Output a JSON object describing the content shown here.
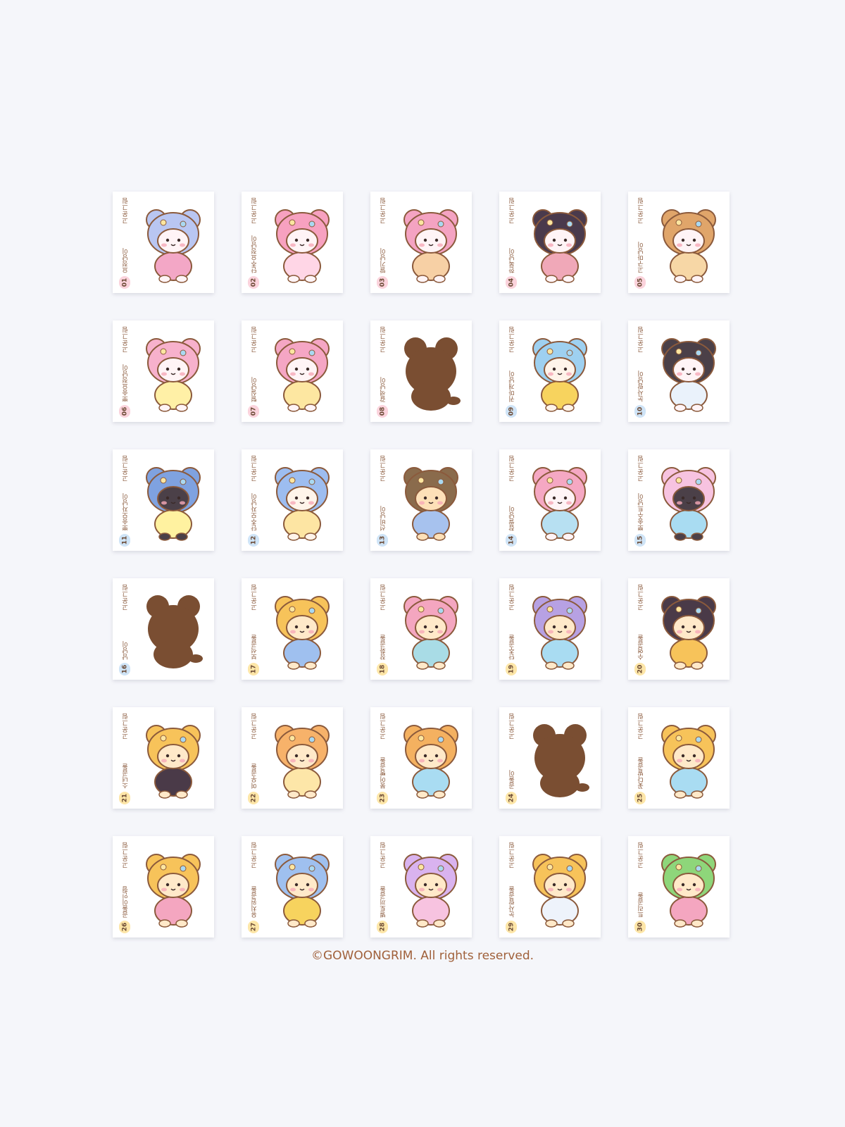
{
  "brand_text": "고운그림",
  "footer": "©GOWOONGRIM. All rights reserved.",
  "stickers": [
    {
      "number": "01",
      "name": "요정냥이",
      "variant": "character",
      "badge_color": "#fbd3dc",
      "colors": [
        "#b9c6f2",
        "#f3a7c6",
        "#fff4f6"
      ]
    },
    {
      "number": "02",
      "name": "단추요정냥이",
      "variant": "character",
      "badge_color": "#fbd3dc",
      "colors": [
        "#f7a1c0",
        "#ffd6e6",
        "#fff4f6"
      ]
    },
    {
      "number": "03",
      "name": "딸기냥이",
      "variant": "character",
      "badge_color": "#fbd3dc",
      "colors": [
        "#f4a3c2",
        "#f7d0a5",
        "#fff4f6"
      ]
    },
    {
      "number": "04",
      "name": "한복냥이",
      "variant": "character",
      "badge_color": "#fbd3dc",
      "colors": [
        "#4a3a4c",
        "#f0a8b8",
        "#fff4f6"
      ]
    },
    {
      "number": "05",
      "name": "고구마냥이",
      "variant": "character",
      "badge_color": "#fbd3dc",
      "colors": [
        "#e0a56a",
        "#f7d7a6",
        "#fff4f6"
      ]
    },
    {
      "number": "06",
      "name": "뽀송요정냥이",
      "variant": "character",
      "badge_color": "#fbd3dc",
      "colors": [
        "#f7b1cc",
        "#fff0a6",
        "#fff4f6"
      ]
    },
    {
      "number": "07",
      "name": "털실냥이",
      "variant": "character",
      "badge_color": "#fbd3dc",
      "colors": [
        "#f5a6c4",
        "#fde7a1",
        "#fff4f6"
      ]
    },
    {
      "number": "08",
      "name": "갈색냥이",
      "variant": "silhouette",
      "badge_color": "#fbd3dc",
      "colors": [
        "#7a4e32",
        "#7a4e32",
        "#7a4e32"
      ]
    },
    {
      "number": "09",
      "name": "귀마개냥이",
      "variant": "character",
      "badge_color": "#cfe4f7",
      "colors": [
        "#9ed0f0",
        "#f7d35e",
        "#fff4ea"
      ]
    },
    {
      "number": "10",
      "name": "눈사람냥이",
      "variant": "character",
      "badge_color": "#cfe4f7",
      "colors": [
        "#4b4048",
        "#eaf2fb",
        "#fff4f6"
      ]
    },
    {
      "number": "11",
      "name": "뽀송모자냥이",
      "variant": "character",
      "badge_color": "#cfe4f7",
      "colors": [
        "#7fa2e0",
        "#fff2a0",
        "#4b4048"
      ]
    },
    {
      "number": "12",
      "name": "단추모자냥이",
      "variant": "character",
      "badge_color": "#cfe4f7",
      "colors": [
        "#9dbdf0",
        "#fde5a3",
        "#fff4ea"
      ]
    },
    {
      "number": "13",
      "name": "선비냥이",
      "variant": "character",
      "badge_color": "#cfe4f7",
      "colors": [
        "#8a6b4c",
        "#a7c2ee",
        "#fde0b8"
      ]
    },
    {
      "number": "14",
      "name": "찹쌀냥이",
      "variant": "character",
      "badge_color": "#cfe4f7",
      "colors": [
        "#f5a8c3",
        "#b7e0f2",
        "#fff4f6"
      ]
    },
    {
      "number": "15",
      "name": "뽀송수트냥이",
      "variant": "character",
      "badge_color": "#cfe4f7",
      "colors": [
        "#f7c3e0",
        "#a9dcf2",
        "#4b4048"
      ]
    },
    {
      "number": "16",
      "name": "냥냥이",
      "variant": "silhouette",
      "badge_color": "#cfe4f7",
      "colors": [
        "#7a4e32",
        "#7a4e32",
        "#7a4e32"
      ]
    },
    {
      "number": "17",
      "name": "보석곰돌",
      "variant": "character",
      "badge_color": "#fde6a8",
      "colors": [
        "#f7c35a",
        "#9fc0ef",
        "#ffe9c9"
      ]
    },
    {
      "number": "18",
      "name": "장화곰돌",
      "variant": "character",
      "badge_color": "#fde6a8",
      "colors": [
        "#f4a6c0",
        "#a9dce6",
        "#ffe9c9"
      ]
    },
    {
      "number": "19",
      "name": "단추곰돌",
      "variant": "character",
      "badge_color": "#fde6a8",
      "colors": [
        "#b7a1e3",
        "#a9dcf2",
        "#ffe9c9"
      ]
    },
    {
      "number": "20",
      "name": "수염곰돌",
      "variant": "character",
      "badge_color": "#fde6a8",
      "colors": [
        "#4a3a48",
        "#f7c35a",
        "#ffe9c9"
      ]
    },
    {
      "number": "21",
      "name": "소녀곰돌",
      "variant": "character",
      "badge_color": "#fde6a8",
      "colors": [
        "#f7c35a",
        "#4a3a48",
        "#ffe9c9"
      ]
    },
    {
      "number": "22",
      "name": "여우곰돌",
      "variant": "character",
      "badge_color": "#fde6a8",
      "colors": [
        "#f7b26a",
        "#fde6a8",
        "#ffe9c9"
      ]
    },
    {
      "number": "23",
      "name": "붕어빵곰돌",
      "variant": "character",
      "badge_color": "#fde6a8",
      "colors": [
        "#f4b160",
        "#a9dcf2",
        "#ffe9c9"
      ]
    },
    {
      "number": "24",
      "name": "곰돌이",
      "variant": "silhouette",
      "badge_color": "#fde6a8",
      "colors": [
        "#7a4e32",
        "#7a4e32",
        "#7a4e32"
      ]
    },
    {
      "number": "25",
      "name": "꽃다발곰돌",
      "variant": "character",
      "badge_color": "#fde6a8",
      "colors": [
        "#f7c35a",
        "#a9dcf2",
        "#ffe9c9"
      ]
    },
    {
      "number": "26",
      "name": "곰돌이인형",
      "variant": "character",
      "badge_color": "#fde6a8",
      "colors": [
        "#f7c35a",
        "#f4a6c0",
        "#ffe9c9"
      ]
    },
    {
      "number": "27",
      "name": "유치원곰돌",
      "variant": "character",
      "badge_color": "#fde6a8",
      "colors": [
        "#9fc0ef",
        "#f7d35e",
        "#ffe9c9"
      ]
    },
    {
      "number": "28",
      "name": "별토끼곰돌",
      "variant": "character",
      "badge_color": "#fde6a8",
      "colors": [
        "#d9b3ef",
        "#f7c3e0",
        "#ffe9c9"
      ]
    },
    {
      "number": "29",
      "name": "눈사람곰돌",
      "variant": "character",
      "badge_color": "#fde6a8",
      "colors": [
        "#f7c35a",
        "#eef3fb",
        "#ffe9c9"
      ]
    },
    {
      "number": "30",
      "name": "트리곰돌",
      "variant": "character",
      "badge_color": "#fde6a8",
      "colors": [
        "#8ed67a",
        "#f4a6c0",
        "#ffe9c9"
      ]
    }
  ]
}
